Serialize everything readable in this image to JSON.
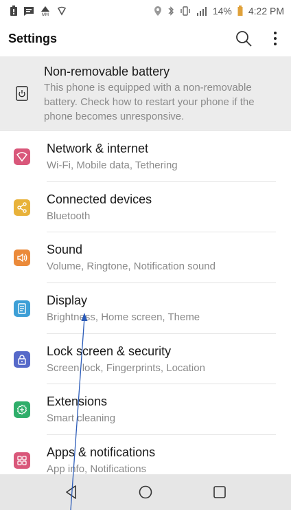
{
  "status_bar": {
    "time": "4:22 PM",
    "battery_percent": "14%",
    "icons_left": [
      "alert-icon",
      "message-icon",
      "mm-triangle-icon",
      "shield-icon"
    ],
    "icons_right": [
      "location-icon",
      "bluetooth-icon",
      "vibrate-icon",
      "signal-icon",
      "battery-icon"
    ]
  },
  "app_bar": {
    "title": "Settings",
    "actions": [
      "search-icon",
      "more-vert-icon"
    ]
  },
  "banner": {
    "title": "Non-removable battery",
    "description": "This phone is equipped with a non-removable battery. Check how to restart your phone if the phone becomes unresponsive.",
    "icon": "power-phone-icon"
  },
  "items": [
    {
      "title": "Network & internet",
      "subtitle": "Wi-Fi, Mobile data, Tethering",
      "icon": "wifi-icon",
      "color": "#d9577a"
    },
    {
      "title": "Connected devices",
      "subtitle": "Bluetooth",
      "icon": "share-icon",
      "color": "#e8b23a"
    },
    {
      "title": "Sound",
      "subtitle": "Volume, Ringtone, Notification sound",
      "icon": "speaker-icon",
      "color": "#eb8a3a"
    },
    {
      "title": "Display",
      "subtitle": "Brightness, Home screen, Theme",
      "icon": "display-icon",
      "color": "#3d9fd6"
    },
    {
      "title": "Lock screen & security",
      "subtitle": "Screen lock, Fingerprints, Location",
      "icon": "lock-icon",
      "color": "#5669c9"
    },
    {
      "title": "Extensions",
      "subtitle": "Smart cleaning",
      "icon": "puzzle-icon",
      "color": "#2fae6a"
    },
    {
      "title": "Apps & notifications",
      "subtitle": "App info, Notifications",
      "icon": "apps-grid-icon",
      "color": "#d9577a"
    }
  ],
  "nav_bar": {
    "buttons": [
      "back-icon",
      "home-icon",
      "recents-icon"
    ]
  },
  "annotation": {
    "color": "#2b5bb8"
  }
}
